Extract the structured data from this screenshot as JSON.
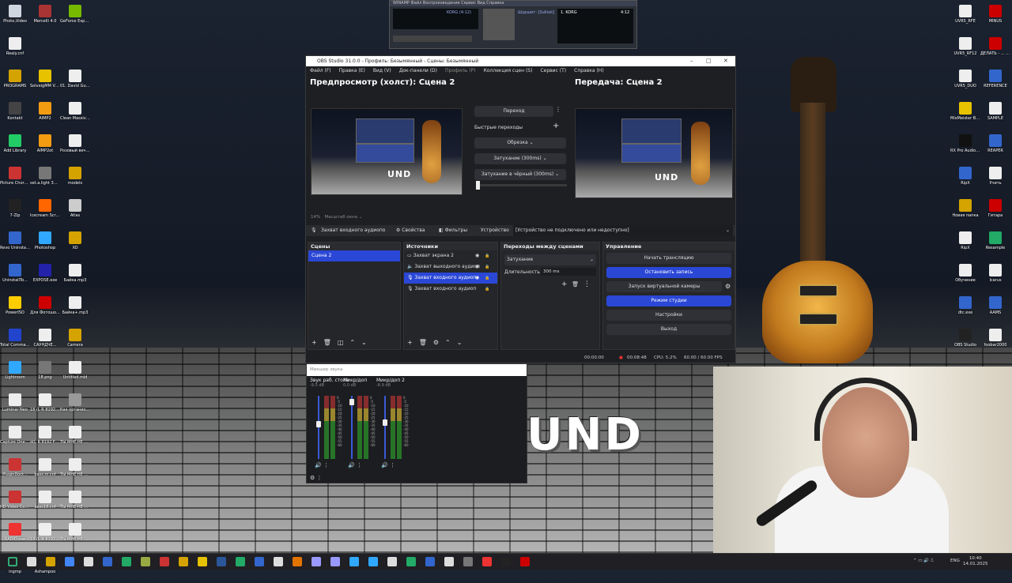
{
  "desktop": {
    "left_icons": [
      {
        "label": "Photo,Video",
        "color": "#cfd6e0"
      },
      {
        "label": "Mercelli 4.0",
        "color": "#a33"
      },
      {
        "label": "GeForce Experience",
        "color": "#76b900"
      },
      {
        "label": "Realy.cnf",
        "color": "#eee"
      },
      {
        "label": "",
        "color": "#000"
      },
      {
        "label": "",
        "color": "#000"
      },
      {
        "label": "PROGRAMS",
        "color": "#d4a300"
      },
      {
        "label": "SolveigMM Video Split...",
        "color": "#e6c200"
      },
      {
        "label": "01. David Guetta, Li...",
        "color": "#eee"
      },
      {
        "label": "Kontakt",
        "color": "#444"
      },
      {
        "label": "AIMP2",
        "color": "#f39c12"
      },
      {
        "label": "Clean Massive.n...",
        "color": "#eee"
      },
      {
        "label": "Add Library",
        "color": "#2c6"
      },
      {
        "label": "AIMP2ot",
        "color": "#f39c12"
      },
      {
        "label": "Розовый вечер.mp3",
        "color": "#eee"
      },
      {
        "label": "Picture Chord Ency...",
        "color": "#c33"
      },
      {
        "label": "set.a.light 3D v2.0",
        "color": "#777"
      },
      {
        "label": "models",
        "color": "#d4a300"
      },
      {
        "label": "7-Zip",
        "color": "#222"
      },
      {
        "label": "Icecream Screen ...",
        "color": "#f60"
      },
      {
        "label": "Atlas",
        "color": "#ccc"
      },
      {
        "label": "Revo Uninstall...",
        "color": "#36c"
      },
      {
        "label": "Photoshop",
        "color": "#31a8ff"
      },
      {
        "label": "XO",
        "color": "#d4a300"
      },
      {
        "label": "UninstallTo...",
        "color": "#36c"
      },
      {
        "label": "EXPOSE.exe",
        "color": "#22a"
      },
      {
        "label": "Байка.mp3",
        "color": "#eee"
      },
      {
        "label": "PowerISO",
        "color": "#fc0"
      },
      {
        "label": "Для Фотошо...",
        "color": "#c00"
      },
      {
        "label": "Байка+.mp3",
        "color": "#eee"
      },
      {
        "label": "Total Command...",
        "color": "#24c"
      },
      {
        "label": "САУНДЧЕ...",
        "color": "#eee"
      },
      {
        "label": "Camera",
        "color": "#d4a300"
      },
      {
        "label": "Lightroom",
        "color": "#31a8ff"
      },
      {
        "label": "18.png",
        "color": "#777"
      },
      {
        "label": "Untitled.mid",
        "color": "#eee"
      },
      {
        "label": "Luminar Neo",
        "color": "#eee"
      },
      {
        "label": "18 (L R 8192 FF Avg-00...",
        "color": "#eee"
      },
      {
        "label": "Как организов...",
        "color": "#999"
      },
      {
        "label": "Capture One 23",
        "color": "#eee"
      },
      {
        "label": "d(L R 8192 FF Avg-00...",
        "color": "#eee"
      },
      {
        "label": "ТЫ МНЕ НЕ МАМА.mp3",
        "color": "#eee"
      },
      {
        "label": "PluginDoct...",
        "color": "#c33"
      },
      {
        "label": "bass.m.cnf",
        "color": "#eee"
      },
      {
        "label": "ТЫ МНЕ НЕ МАМА+.mp3",
        "color": "#eee"
      },
      {
        "label": "HD Video Conv.Fact...",
        "color": "#c33"
      },
      {
        "label": "bass18.cnf",
        "color": "#eee"
      },
      {
        "label": "ТЫ МНЕ НЕ МАМА+...",
        "color": "#eee"
      },
      {
        "label": "RADIO.exe",
        "color": "#e33"
      },
      {
        "label": "18 (L R 8192 FF Avg-00...",
        "color": "#eee"
      },
      {
        "label": "ТЫ МНЕ НЕ МАМА.mp3",
        "color": "#eee"
      },
      {
        "label": "ingmp",
        "color": "#2a2"
      },
      {
        "label": "Ashampoo",
        "color": "#eee"
      },
      {
        "label": "",
        "color": "#000"
      }
    ],
    "right_icons": [
      {
        "label": "UVR5_RFE",
        "color": "#eee"
      },
      {
        "label": "MINUS",
        "color": "#c00"
      },
      {
        "label": "UVR5_RF12",
        "color": "#eee"
      },
      {
        "label": "ДЕЛАТЬ - ... ылык",
        "color": "#c00"
      },
      {
        "label": "UVR5_DUO",
        "color": "#eee"
      },
      {
        "label": "REFERENCE",
        "color": "#36c"
      },
      {
        "label": "MixMeister BPM Ana...",
        "color": "#e6c200"
      },
      {
        "label": "SAMPLE",
        "color": "#eee"
      },
      {
        "label": "RX Pro Audio Editor",
        "color": "#111"
      },
      {
        "label": "REAPER",
        "color": "#36c"
      },
      {
        "label": "RipX",
        "color": "#36c"
      },
      {
        "label": "Учить",
        "color": "#eee"
      },
      {
        "label": "Новая папка",
        "color": "#d4a300"
      },
      {
        "label": "Гитара",
        "color": "#c00"
      },
      {
        "label": "RipX",
        "color": "#eee"
      },
      {
        "label": "Resample",
        "color": "#2a6"
      },
      {
        "label": "Обучение",
        "color": "#eee"
      },
      {
        "label": "Icarus",
        "color": "#eee"
      },
      {
        "label": "dtc.exe",
        "color": "#36c"
      },
      {
        "label": "AAMS",
        "color": "#36c"
      },
      {
        "label": "OBS Studio",
        "color": "#222"
      },
      {
        "label": "foobar2000",
        "color": "#eee"
      }
    ]
  },
  "winamp": {
    "menu": "WINAMP  Файл  Воспроизведение  Сервис  Вид  Справка",
    "track_short": "KORG (4:12)",
    "bitrate": "Шуршит: [Sullost]",
    "track": "1. KORG",
    "time": "4:12"
  },
  "obs": {
    "title": "OBS Studio 31.0.0 - Профиль: Безымянный - Сцены: Безымянный",
    "menu": [
      "Файл (F)",
      "Правка (E)",
      "Вид (V)",
      "Док-панели (D)",
      "Профиль (P)",
      "Коллекция сцен (S)",
      "Сервис (T)",
      "Справка (H)"
    ],
    "preview_title": "Предпросмотр (холст): Сцена 2",
    "program_title": "Передача: Сцена 2",
    "preview_art_text": "UND",
    "transition_button": "Переход",
    "quick_transitions": "Быстрые переходы",
    "quick_transition_items": [
      "Обрезка",
      "Затухание (300ms)",
      "Затухание в чёрный (300ms)"
    ],
    "zoom_pct": "14%",
    "zoom_label": "Масштаб окна",
    "source_toolbar": {
      "source": "Захват входного аудиопо",
      "properties": "Свойства",
      "filters": "Фильтры",
      "device_label": "Устройство",
      "device_value": "[Устройство не подключено или недоступно]"
    },
    "scenes": {
      "title": "Сцены",
      "items": [
        "Сцена 2"
      ],
      "selected": 0
    },
    "sources": {
      "title": "Источники",
      "items": [
        "Захват экрана 2",
        "Захват выходного аудиоп",
        "Захват входного аудиоп",
        "Захват входного аудиоп"
      ],
      "selected": 2
    },
    "transitions": {
      "title": "Переходы между сценами",
      "type": "Затухание",
      "duration_label": "Длительность",
      "duration_value": "300 ms"
    },
    "controls": {
      "title": "Управление",
      "buttons": [
        {
          "label": "Начать трансляцию",
          "active": false
        },
        {
          "label": "Остановить запись",
          "active": true
        },
        {
          "label": "Запуск виртуальной камеры",
          "active": false
        },
        {
          "label": "Режим студии",
          "active": true
        },
        {
          "label": "Настройки",
          "active": false
        },
        {
          "label": "Выход",
          "active": false
        }
      ]
    },
    "status": {
      "stream_time": "00:00:00",
      "rec_time": "00:08:48",
      "cpu": "CPU: 5.2%",
      "fps": "60.00 / 60.00 FPS"
    }
  },
  "mixer": {
    "title": "Микшер звука",
    "channels": [
      {
        "name": "Звук раб. стола",
        "db": "-9.5 dB",
        "level": 0.55
      },
      {
        "name": "Микр/доп",
        "db": "0.0 dB",
        "level": 0.95
      },
      {
        "name": "Микр/доп 2",
        "db": "-8.9 dB",
        "level": 0.58
      }
    ],
    "scale": [
      "0",
      "-5",
      "-10",
      "-15",
      "-20",
      "-25",
      "-30",
      "-35",
      "-40",
      "-45",
      "-50",
      "-55",
      "-60"
    ]
  },
  "overlay_text": "UND",
  "taskbar": {
    "lang": "ENG",
    "time": "10:40",
    "date": "14.01.2025",
    "icons": [
      "#3a7",
      "#ddd",
      "#d4a300",
      "#4285f4",
      "#ddd",
      "#36c",
      "#2a6",
      "#9a4",
      "#c33",
      "#d4a300",
      "#e6c200",
      "#2b579a",
      "#2a6",
      "#36c",
      "#ddd",
      "#e37400",
      "#9999ff",
      "#9999ff",
      "#31a8ff",
      "#31a8ff",
      "#ddd",
      "#2a6",
      "#36c",
      "#ddd",
      "#777",
      "#e33",
      "#222",
      "#c00"
    ]
  }
}
